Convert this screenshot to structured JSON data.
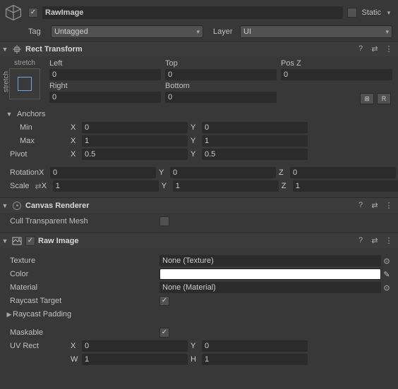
{
  "header": {
    "name": "RawImage",
    "static_label": "Static",
    "static_checked": false,
    "enabled": true
  },
  "tagrow": {
    "tag_label": "Tag",
    "tag_value": "Untagged",
    "layer_label": "Layer",
    "layer_value": "UI"
  },
  "rect_transform": {
    "title": "Rect Transform",
    "anchor_label_h": "stretch",
    "anchor_label_v": "stretch",
    "cols": {
      "left": {
        "label": "Left",
        "value": "0"
      },
      "top": {
        "label": "Top",
        "value": "0"
      },
      "posz": {
        "label": "Pos Z",
        "value": "0"
      },
      "right": {
        "label": "Right",
        "value": "0"
      },
      "bottom": {
        "label": "Bottom",
        "value": "0"
      }
    },
    "blueprint_btn": "⊞",
    "raw_btn": "R",
    "anchors_label": "Anchors",
    "min": {
      "label": "Min",
      "x": "0",
      "y": "0"
    },
    "max": {
      "label": "Max",
      "x": "1",
      "y": "1"
    },
    "pivot": {
      "label": "Pivot",
      "x": "0.5",
      "y": "0.5"
    },
    "rotation": {
      "label": "Rotation",
      "x": "0",
      "y": "0",
      "z": "0"
    },
    "scale": {
      "label": "Scale",
      "x": "1",
      "y": "1",
      "z": "1"
    }
  },
  "canvas_renderer": {
    "title": "Canvas Renderer",
    "cull_label": "Cull Transparent Mesh",
    "cull_checked": false
  },
  "raw_image": {
    "title": "Raw Image",
    "enabled": true,
    "texture_label": "Texture",
    "texture_value": "None (Texture)",
    "color_label": "Color",
    "material_label": "Material",
    "material_value": "None (Material)",
    "raycast_target_label": "Raycast Target",
    "raycast_target_checked": true,
    "raycast_padding_label": "Raycast Padding",
    "maskable_label": "Maskable",
    "maskable_checked": true,
    "uvrect_label": "UV Rect",
    "uvrect": {
      "x": "0",
      "y": "0",
      "w": "1",
      "h": "1"
    }
  },
  "axes": {
    "X": "X",
    "Y": "Y",
    "Z": "Z",
    "W": "W",
    "H": "H"
  }
}
